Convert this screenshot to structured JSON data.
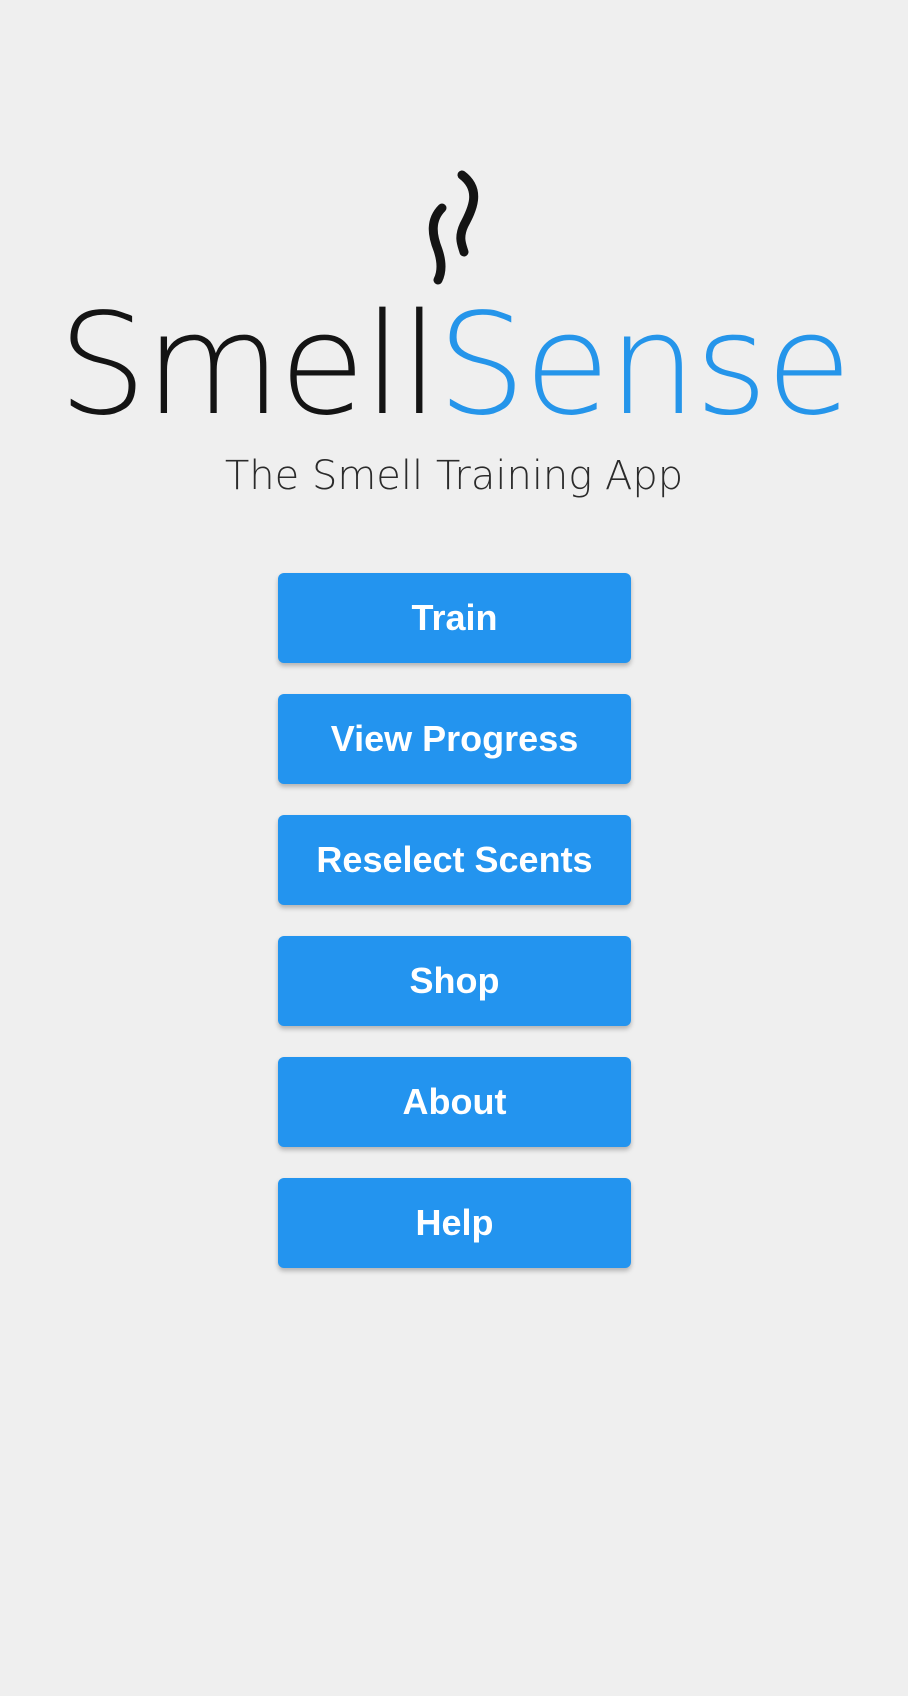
{
  "app": {
    "logo_icon": "steam-smell-icon",
    "brand_part_1": "Smell",
    "brand_part_2": "Sense",
    "tagline": "The Smell Training App"
  },
  "colors": {
    "background": "#efefef",
    "accent": "#2394ef",
    "brand_dark": "#141414",
    "brand_blue": "#2595ea"
  },
  "menu": {
    "items": [
      {
        "label": "Train"
      },
      {
        "label": "View Progress"
      },
      {
        "label": "Reselect Scents"
      },
      {
        "label": "Shop"
      },
      {
        "label": "About"
      },
      {
        "label": "Help"
      }
    ]
  }
}
